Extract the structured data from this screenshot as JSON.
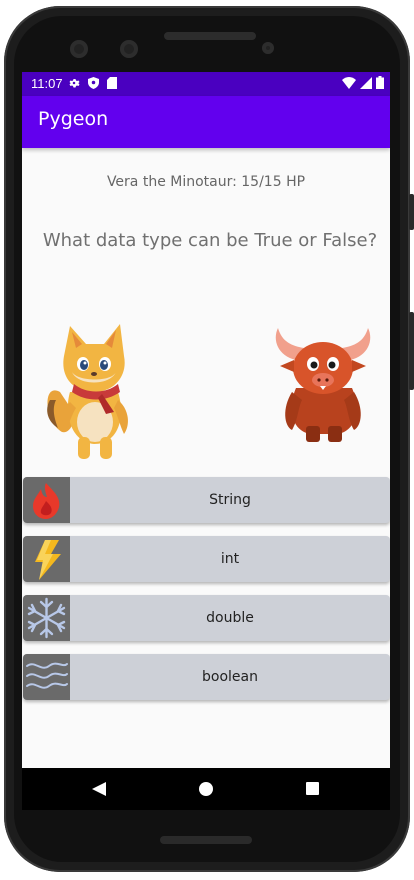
{
  "status_bar": {
    "time": "11:07",
    "left_icons": [
      "gear-icon",
      "shield-icon",
      "sd-card-icon"
    ],
    "right_icons": [
      "wifi-icon",
      "signal-icon",
      "battery-icon"
    ]
  },
  "app_bar": {
    "title": "Pygeon",
    "color": "#6200ee"
  },
  "battle": {
    "enemy_status": "Vera the Minotaur: 15/15 HP",
    "question": "What data type can be True or False?",
    "player_sprite": "fox-character",
    "enemy_sprite": "minotaur-character"
  },
  "answers": [
    {
      "label": "String",
      "icon": "fire-icon"
    },
    {
      "label": "int",
      "icon": "lightning-icon"
    },
    {
      "label": "double",
      "icon": "snowflake-icon"
    },
    {
      "label": "boolean",
      "icon": "wind-icon"
    }
  ],
  "nav": {
    "back": "back-triangle-icon",
    "home": "home-circle-icon",
    "recents": "recents-square-icon"
  }
}
